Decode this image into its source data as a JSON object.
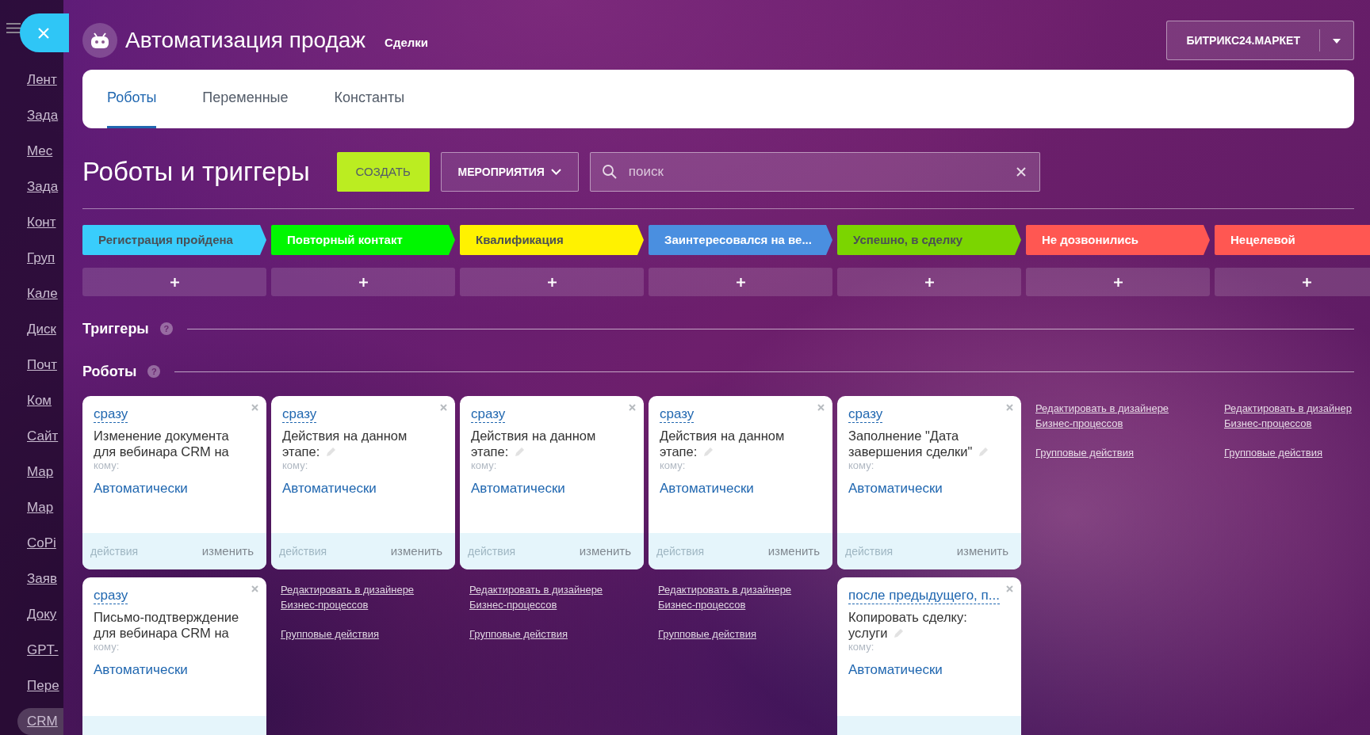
{
  "sidebar": {
    "items": [
      {
        "label": "Лент",
        "selected": false
      },
      {
        "label": "Зада",
        "selected": false
      },
      {
        "label": "Мес",
        "selected": false
      },
      {
        "label": "Зада",
        "selected": false
      },
      {
        "label": "Конт",
        "selected": false
      },
      {
        "label": "Груп",
        "selected": false
      },
      {
        "label": "Кале",
        "selected": false
      },
      {
        "label": "Диск",
        "selected": false
      },
      {
        "label": "Почт",
        "selected": false
      },
      {
        "label": "Ком",
        "selected": false
      },
      {
        "label": "Сайт",
        "selected": false
      },
      {
        "label": "Мар",
        "selected": false
      },
      {
        "label": "Мар",
        "selected": false
      },
      {
        "label": "CoPi",
        "selected": false
      },
      {
        "label": "Заяв",
        "selected": false
      },
      {
        "label": "Доку",
        "selected": false
      },
      {
        "label": "GPT-",
        "selected": false
      },
      {
        "label": "Пере",
        "selected": false
      },
      {
        "label": "CRM",
        "selected": true
      }
    ]
  },
  "header": {
    "title": "Автоматизация продаж",
    "subtitle": "Сделки",
    "market_button": "БИТРИКС24.МАРКЕТ"
  },
  "tabs": [
    {
      "label": "Роботы",
      "selected": true
    },
    {
      "label": "Переменные",
      "selected": false
    },
    {
      "label": "Константы",
      "selected": false
    }
  ],
  "toolbar": {
    "heading": "Роботы и триггеры",
    "create_button": "СОЗДАТЬ",
    "events_button": "МЕРОПРИЯТИЯ",
    "search": {
      "placeholder": "поиск"
    }
  },
  "stages": [
    {
      "name": "Регистрация пройдена",
      "color": "#39cdfc"
    },
    {
      "name": "Повторный контакт",
      "color": "#00f700"
    },
    {
      "name": "Квалификация",
      "color": "#fff200"
    },
    {
      "name": "Заинтересовался на ве...",
      "color": "#4a8fe0"
    },
    {
      "name": "Успешно, в сделку",
      "color": "#7bd500"
    },
    {
      "name": "Не дозвонились",
      "color": "#ff5752"
    },
    {
      "name": "Нецелевой",
      "color": "#ff5752"
    }
  ],
  "sections": [
    {
      "title": "Триггеры",
      "help": "?"
    },
    {
      "title": "Роботы",
      "help": "?"
    }
  ],
  "robot_columns": [
    {
      "robots": [
        {
          "delay": "сразу",
          "title": "Изменение документа для вебинара CRM на",
          "editable": false,
          "to_label": "кому:",
          "to_value": "Автоматически",
          "actions": "действия",
          "edit": "изменить"
        },
        {
          "delay": "сразу",
          "title": "Письмо-подтверждение для вебинара CRM на",
          "editable": false,
          "to_label": "кому:",
          "to_value": "Автоматически"
        }
      ]
    },
    {
      "robots": [
        {
          "delay": "сразу",
          "title": "Действия на данном этапе:",
          "editable": true,
          "to_label": "кому:",
          "to_value": "Автоматически",
          "actions": "действия",
          "edit": "изменить"
        }
      ],
      "links": [
        [
          "Редактировать в дизайнере",
          "Бизнес-процессов"
        ],
        [
          "Групповые действия"
        ]
      ]
    },
    {
      "robots": [
        {
          "delay": "сразу",
          "title": "Действия на данном этапе:",
          "editable": true,
          "to_label": "кому:",
          "to_value": "Автоматически",
          "actions": "действия",
          "edit": "изменить"
        }
      ],
      "links": [
        [
          "Редактировать в дизайнере",
          "Бизнес-процессов"
        ],
        [
          "Групповые действия"
        ]
      ]
    },
    {
      "robots": [
        {
          "delay": "сразу",
          "title": "Действия на данном этапе:",
          "editable": true,
          "to_label": "кому:",
          "to_value": "Автоматически",
          "actions": "действия",
          "edit": "изменить"
        }
      ],
      "links": [
        [
          "Редактировать в дизайнере",
          "Бизнес-процессов"
        ],
        [
          "Групповые действия"
        ]
      ]
    },
    {
      "robots": [
        {
          "delay": "сразу",
          "title": "Заполнение \"Дата завершения сделки\"",
          "editable": true,
          "to_label": "кому:",
          "to_value": "Автоматически",
          "actions": "действия",
          "edit": "изменить"
        },
        {
          "delay": "после предыдущего, п...",
          "title": "Копировать сделку: услуги",
          "editable": true,
          "to_label": "кому:",
          "to_value": "Автоматически"
        }
      ]
    },
    {
      "links": [
        [
          "Редактировать в дизайнере",
          "Бизнес-процессов"
        ],
        [
          "Групповые действия"
        ]
      ]
    },
    {
      "links": [
        [
          "Редактировать в дизайнер",
          "Бизнес-процессов"
        ],
        [
          "Групповые действия"
        ]
      ]
    }
  ]
}
